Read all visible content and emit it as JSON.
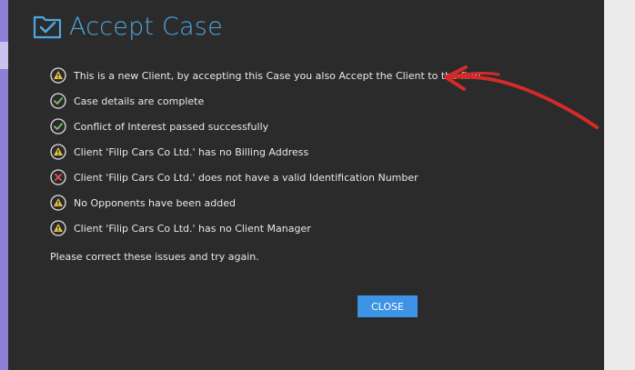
{
  "dialog": {
    "title": "Accept Case",
    "title_icon": "checked-folder-icon",
    "messages": [
      {
        "status": "warning",
        "icon": "warning-icon",
        "text": "This is a new Client, by accepting this Case you also Accept the Client to the firm"
      },
      {
        "status": "success",
        "icon": "check-icon",
        "text": "Case details are complete"
      },
      {
        "status": "success",
        "icon": "check-icon",
        "text": "Conflict of Interest passed successfully"
      },
      {
        "status": "warning",
        "icon": "warning-icon",
        "text": "Client 'Filip Cars Co Ltd.' has no Billing Address"
      },
      {
        "status": "error",
        "icon": "error-icon",
        "text": "Client 'Filip Cars Co Ltd.' does not have a valid Identification Number"
      },
      {
        "status": "warning",
        "icon": "warning-icon",
        "text": "No Opponents have been added"
      },
      {
        "status": "warning",
        "icon": "warning-icon",
        "text": "Client 'Filip Cars Co Ltd.' has no Client Manager"
      }
    ],
    "footer": "Please correct these issues and try again.",
    "close_label": "CLOSE"
  },
  "annotation": {
    "icon": "red-arrow-icon",
    "color": "#d42a2a"
  },
  "colors": {
    "dialog_bg": "#2b2b2b",
    "title": "#4ea7e4",
    "button": "#3d93e6",
    "warning": "#e3c33a",
    "success": "#7cc56b",
    "error": "#e05353",
    "sidebar": "#8c7fd6"
  }
}
